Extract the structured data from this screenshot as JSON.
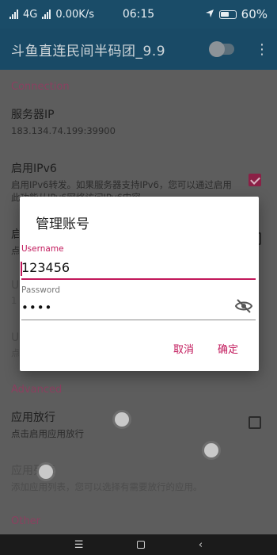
{
  "status_bar": {
    "network": "4G",
    "speed": "0.00K/s",
    "time": "06:15",
    "battery": "60%"
  },
  "app_bar": {
    "title": "斗鱼直连民间半码团_9.9",
    "toggle_on": false
  },
  "sections": {
    "connection": "Connection",
    "advanced": "Advanced",
    "other": "Other"
  },
  "prefs": {
    "server_ip": {
      "title": "服务器IP",
      "summary": "183.134.74.199:39900"
    },
    "ipv6": {
      "title": "启用IPv6",
      "summary": "启用IPv6转发。如果服务器支持IPv6，您可以通过启用此功能从IPv6网络访问IPv6内容。",
      "checked": true
    },
    "hidden1": {
      "title": "启",
      "summary": "点"
    },
    "hidden2": {
      "title": "U",
      "summary": "1"
    },
    "hidden3": {
      "title": "U",
      "summary": "点"
    },
    "app_allow": {
      "title": "应用放行",
      "summary": "点击启用应用放行",
      "checked": false
    },
    "app_list": {
      "title": "应用列表",
      "summary": "添加应用列表，您可以选择有需要放行的应用。"
    }
  },
  "dialog": {
    "title": "管理账号",
    "username_label": "Username",
    "username_value": "123456",
    "password_label": "Password",
    "password_value": "••••",
    "cancel": "取消",
    "ok": "确定"
  },
  "colors": {
    "accent": "#c2185b",
    "appbar": "#194a66"
  }
}
